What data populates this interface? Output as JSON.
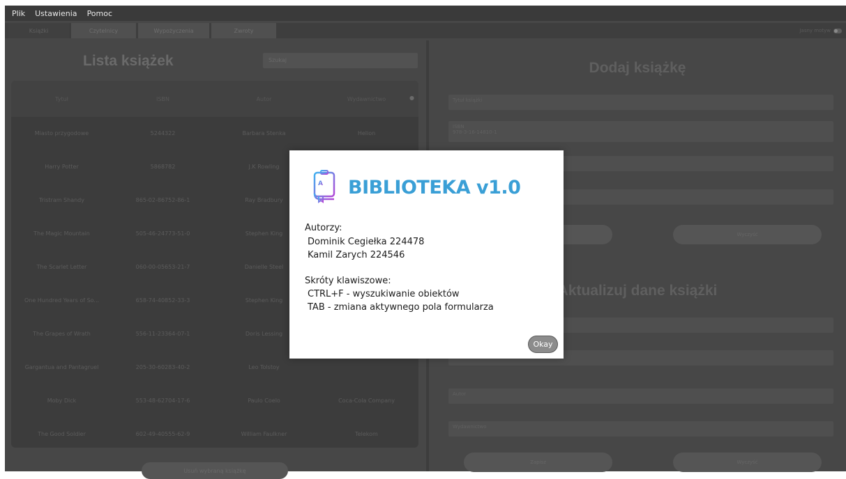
{
  "menu": [
    "Plik",
    "Ustawienia",
    "Pomoc"
  ],
  "tabs": [
    "Książki",
    "Czytelnicy",
    "Wypożyczenia",
    "Zwroty"
  ],
  "theme_toggle_label": "Jasny motyw",
  "left": {
    "title": "Lista książek",
    "search_placeholder": "Szukaj",
    "columns": [
      "Tytuł",
      "ISBN",
      "Autor",
      "Wydawnictwo"
    ],
    "rows": [
      [
        "Miasto przygodowe",
        "5244322",
        "Barbara Stenka",
        "Helion"
      ],
      [
        "Harry Potter",
        "5868782",
        "J.K Rowling",
        ""
      ],
      [
        "Tristram Shandy",
        "865-02-86752-86-1",
        "Ray Bradbury",
        ""
      ],
      [
        "The Magic Mountain",
        "505-46-24773-51-0",
        "Stephen King",
        ""
      ],
      [
        "The Scarlet Letter",
        "060-00-05653-21-7",
        "Danielle Steel",
        ""
      ],
      [
        "One Hundred Years of So...",
        "658-74-40852-33-3",
        "Stephen King",
        ""
      ],
      [
        "The Grapes of Wrath",
        "556-11-23364-07-1",
        "Doris Lessing",
        ""
      ],
      [
        "Gargantua and Pantagruel",
        "205-30-60283-40-2",
        "Leo Tolstoy",
        ""
      ],
      [
        "Moby Dick",
        "553-48-62704-17-6",
        "Paulo Coelo",
        "Coca-Cola Company"
      ],
      [
        "The Good Soldier",
        "602-49-40555-62-9",
        "William Faulkner",
        "Telekom"
      ]
    ],
    "bottom_button": "Usuń wybraną książkę"
  },
  "right": {
    "title_add": "Dodaj książkę",
    "add_fields": [
      "Tytuł książki",
      "ISBN\n978-3-16-14810-1",
      "",
      ""
    ],
    "add_buttons": [
      "Zapisz",
      "Wyczyść"
    ],
    "title_update": "Aktualizuj dane książki",
    "update_fields": [
      "",
      "",
      "Autor",
      "Wydawnictwo"
    ],
    "update_buttons": [
      "Zapisz",
      "Wyczyść"
    ]
  },
  "dialog": {
    "icon": "book-icon",
    "title": "BIBLIOTEKA v1.0",
    "authors_label": "Autorzy:",
    "author1": "Dominik Cegiełka 224478",
    "author2": "Kamil Zarych 224546",
    "shortcuts_label": "Skróty klawiszowe:",
    "shortcut1": "CTRL+F - wyszukiwanie obiektów",
    "shortcut2": "TAB - zmiana aktywnego pola formularza",
    "ok_label": "Okay",
    "colors": {
      "title": "#3a9fd6",
      "icon_gradient_start": "#3fb2f0",
      "icon_gradient_end": "#b446d6"
    }
  }
}
